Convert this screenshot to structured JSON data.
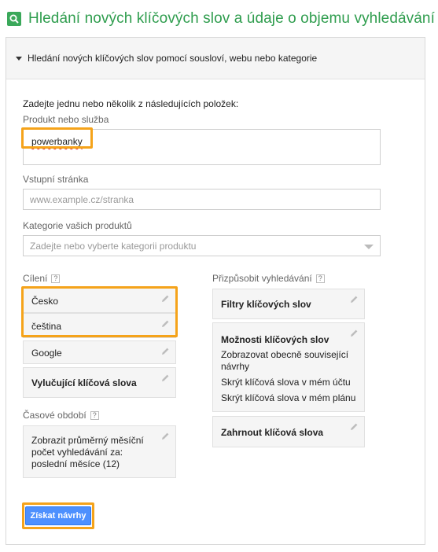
{
  "header": {
    "title": "Hledání nových klíčových slov a údaje o objemu vyhledávání"
  },
  "panel": {
    "title": "Hledání nových klíčových slov pomocí sousloví, webu nebo kategorie",
    "intro": "Zadejte jednu nebo několik z následujících položek:",
    "product": {
      "label": "Produkt nebo služba",
      "value": "powerbanky"
    },
    "landing": {
      "label": "Vstupní stránka",
      "placeholder": "www.example.cz/stranka"
    },
    "category": {
      "label": "Kategorie vašich produktů",
      "placeholder": "Zadejte nebo vyberte kategorii produktu"
    },
    "targeting": {
      "label": "Cílení",
      "help": "?",
      "items": [
        "Česko",
        "čeština",
        "Google"
      ],
      "negative": "Vylučující klíčová slova"
    },
    "period": {
      "label": "Časové období",
      "help": "?",
      "lines": [
        "Zobrazit průměrný měsíční",
        "počet vyhledávání za:",
        "poslední měsíce (12)"
      ]
    },
    "customize": {
      "label": "Přizpůsobit vyhledávání",
      "help": "?",
      "filters": "Filtry klíčových slov",
      "options": {
        "title": "Možnosti klíčových slov",
        "lines": [
          "Zobrazovat obecně související",
          "návrhy",
          "Skrýt klíčová slova v mém účtu",
          "Skrýt klíčová slova v mém plánu"
        ]
      },
      "include": "Zahrnout klíčová slova"
    },
    "submit": "Získat návrhy"
  },
  "colors": {
    "accent_green": "#2f9d4e",
    "highlight_orange": "#f5a31a",
    "button_blue": "#4d90fe"
  }
}
